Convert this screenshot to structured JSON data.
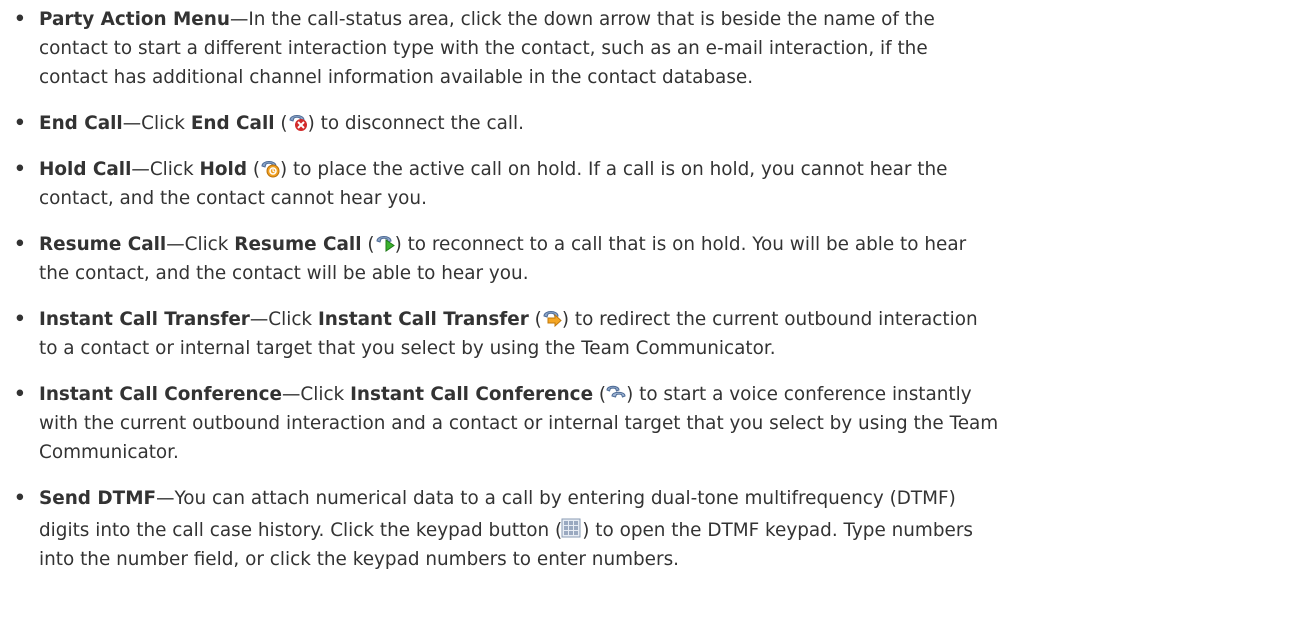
{
  "items": [
    {
      "term": "Party Action Menu",
      "dash": "—",
      "text_lead": "In the call-status area, click the down arrow that is beside the name of the",
      "lines": [
        "contact to start a different interaction type with the contact, such as an e-mail interaction, if the",
        "contact has additional channel information available in the contact database."
      ]
    },
    {
      "term": "End Call",
      "dash": "—Click ",
      "button": "End Call",
      "open_paren": " (",
      "icon": "end-call-icon",
      "after_icon": ") to disconnect the call."
    },
    {
      "term": "Hold Call",
      "dash": "—Click ",
      "button": "Hold",
      "open_paren": " (",
      "icon": "hold-call-icon",
      "after_icon": ") to place the active call on hold. If a call is on hold, you cannot hear the",
      "lines": [
        "contact, and the contact cannot hear you."
      ]
    },
    {
      "term": "Resume Call",
      "dash": "—Click ",
      "button": "Resume Call",
      "open_paren": " (",
      "icon": "resume-call-icon",
      "after_icon": ") to reconnect to a call that is on hold. You will be able to hear",
      "lines": [
        "the contact, and the contact will be able to hear you."
      ]
    },
    {
      "term": "Instant Call Transfer",
      "dash": "—Click ",
      "button": "Instant Call Transfer",
      "open_paren": " (",
      "icon": "instant-call-transfer-icon",
      "after_icon": ") to redirect the current outbound interaction",
      "lines": [
        "to a contact or internal target that you select by using the Team Communicator."
      ]
    },
    {
      "term": "Instant Call Conference",
      "dash": "—Click ",
      "button": "Instant Call Conference",
      "open_paren": " (",
      "icon": "instant-call-conference-icon",
      "after_icon": ") to start a voice conference instantly",
      "lines": [
        "with the current outbound interaction and a contact or internal target that you select by using the Team",
        "Communicator."
      ]
    },
    {
      "term": "Send DTMF",
      "dash": "—",
      "text_lead": "You can attach numerical data to a call by entering dual-tone multifrequency (DTMF)",
      "line2_pre": "digits into the call case history. Click the keypad button (",
      "icon": "keypad-icon",
      "line2_post": ") to open the DTMF keypad. Type numbers",
      "lines": [
        "into the number field, or click the keypad numbers to enter numbers."
      ]
    }
  ],
  "bullet_char": "•"
}
